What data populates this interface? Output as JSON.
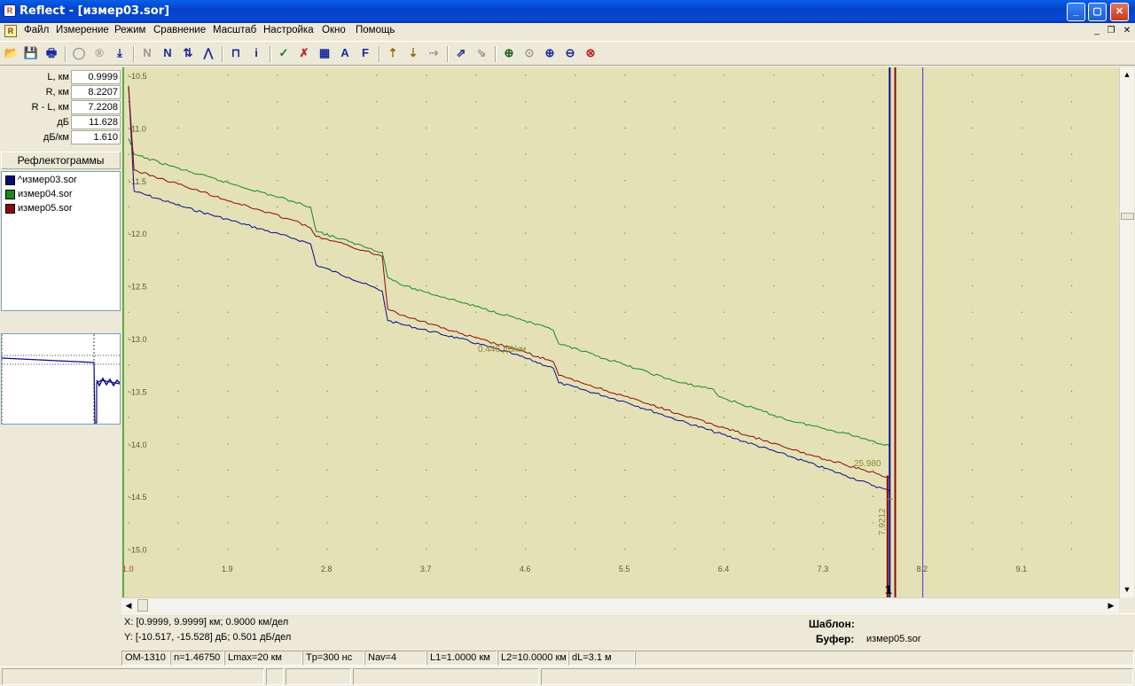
{
  "window": {
    "title": "Reflect - [измер03.sor]",
    "minimize_glyph": "_",
    "maximize_glyph": "▢",
    "close_glyph": "✕",
    "app_icon": "reflect-app-icon",
    "app_icon_glyph": "R"
  },
  "menu": {
    "doc_icon_glyph": "R",
    "items": [
      "Файл",
      "Измерение",
      "Режим",
      "Сравнение",
      "Масштаб",
      "Настройка",
      "Окно",
      "Помощь"
    ],
    "mdi_minimize": "_",
    "mdi_restore": "❐",
    "mdi_close": "✕"
  },
  "toolbar": {
    "icons": [
      {
        "name": "open-icon",
        "glyph": "📂"
      },
      {
        "name": "save-icon",
        "glyph": "💾"
      },
      {
        "name": "print-icon",
        "glyph": "🖶"
      },
      {
        "name": "measure-icon",
        "glyph": "◯"
      },
      {
        "name": "record-icon",
        "glyph": "®"
      },
      {
        "name": "download-icon",
        "glyph": "⤓"
      },
      {
        "name": "marker-n-disabled-icon",
        "glyph": "N"
      },
      {
        "name": "marker-n-icon",
        "glyph": "N"
      },
      {
        "name": "marker-n-arrows-icon",
        "glyph": "⇅"
      },
      {
        "name": "marker-n-peak-icon",
        "glyph": "⋀"
      },
      {
        "name": "event-table-icon",
        "glyph": "⊓"
      },
      {
        "name": "info-icon",
        "glyph": "i"
      },
      {
        "name": "check-icon",
        "glyph": "✓"
      },
      {
        "name": "delete-marker-icon",
        "glyph": "✗"
      },
      {
        "name": "table-icon",
        "glyph": "▦"
      },
      {
        "name": "font-a-icon",
        "glyph": "A"
      },
      {
        "name": "font-f-icon",
        "glyph": "F"
      },
      {
        "name": "compare-up-icon",
        "glyph": "⇡"
      },
      {
        "name": "compare-down-icon",
        "glyph": "⇣"
      },
      {
        "name": "compare-disabled-icon",
        "glyph": "⇢"
      },
      {
        "name": "export-icon",
        "glyph": "⇗"
      },
      {
        "name": "export-disabled-icon",
        "glyph": "⇘"
      },
      {
        "name": "zoom-in-icon",
        "glyph": "⊕"
      },
      {
        "name": "zoom-disabled-icon",
        "glyph": "⊙"
      },
      {
        "name": "zoom-fit-in-icon",
        "glyph": "⊕"
      },
      {
        "name": "zoom-fit-out-icon",
        "glyph": "⊖"
      },
      {
        "name": "zoom-reset-icon",
        "glyph": "⊗"
      }
    ]
  },
  "measurements": [
    {
      "label": "L, км",
      "value": "0.9999"
    },
    {
      "label": "R, км",
      "value": "8.2207"
    },
    {
      "label": "R - L, км",
      "value": "7.2208"
    },
    {
      "label": "дБ",
      "value": "11.628"
    },
    {
      "label": "дБ/км",
      "value": "1.610"
    }
  ],
  "reflectograms": {
    "header": "Рефлектограммы",
    "items": [
      {
        "name": "^измер03.sor",
        "color": "#0a0a78"
      },
      {
        "name": "измер04.sor",
        "color": "#1a8a1a"
      },
      {
        "name": "измер05.sor",
        "color": "#8a0a0a"
      }
    ]
  },
  "chart_data": {
    "type": "line",
    "x_ticks": [
      "1.0",
      "1.9",
      "2.8",
      "3.7",
      "4.6",
      "5.5",
      "6.4",
      "7.3",
      "8.2",
      "9.1"
    ],
    "y_ticks": [
      "-10.5",
      "-11.0",
      "-11.5",
      "-12.0",
      "-12.5",
      "-13.0",
      "-13.5",
      "-14.0",
      "-14.5",
      "-15.0"
    ],
    "xlim": [
      1.0,
      10.0
    ],
    "ylim": [
      -15.2,
      -10.4
    ],
    "grid": "dotted",
    "series": [
      {
        "name": "измер03.sor",
        "color": "#0a0a8a",
        "x": [
          1.0,
          1.05,
          1.5,
          2.0,
          2.5,
          2.65,
          2.7,
          3.0,
          3.3,
          3.35,
          3.5,
          4.0,
          4.5,
          4.85,
          4.9,
          5.5,
          6.0,
          6.5,
          7.0,
          7.5,
          7.9
        ],
        "y": [
          -10.6,
          -11.6,
          -11.75,
          -11.9,
          -12.05,
          -12.1,
          -12.3,
          -12.42,
          -12.55,
          -12.83,
          -12.87,
          -13.0,
          -13.15,
          -13.28,
          -13.42,
          -13.6,
          -13.78,
          -13.95,
          -14.12,
          -14.3,
          -14.45
        ]
      },
      {
        "name": "измер04.sor",
        "color": "#1a8a1a",
        "x": [
          1.0,
          1.05,
          1.5,
          2.0,
          2.5,
          2.65,
          2.7,
          3.0,
          3.3,
          3.35,
          3.5,
          4.0,
          4.5,
          4.85,
          4.9,
          5.5,
          6.0,
          6.3,
          6.35,
          7.0,
          7.5,
          7.9
        ],
        "y": [
          -11.1,
          -11.25,
          -11.4,
          -11.55,
          -11.7,
          -11.75,
          -11.98,
          -12.08,
          -12.18,
          -12.42,
          -12.5,
          -12.65,
          -12.8,
          -12.92,
          -13.05,
          -13.25,
          -13.42,
          -13.48,
          -13.55,
          -13.78,
          -13.9,
          -14.02
        ]
      },
      {
        "name": "измер05.sor",
        "color": "#8a0a0a",
        "x": [
          1.0,
          1.05,
          1.5,
          2.0,
          2.5,
          2.65,
          2.7,
          3.0,
          3.3,
          3.35,
          3.5,
          4.0,
          4.5,
          4.85,
          4.9,
          5.5,
          6.0,
          6.5,
          7.0,
          7.5,
          7.9
        ],
        "y": [
          -10.6,
          -11.4,
          -11.55,
          -11.72,
          -11.88,
          -11.95,
          -12.03,
          -12.12,
          -12.22,
          -12.72,
          -12.78,
          -12.95,
          -13.1,
          -13.22,
          -13.35,
          -13.55,
          -13.72,
          -13.88,
          -14.05,
          -14.2,
          -14.32
        ]
      }
    ],
    "annotations": {
      "slope_label": "0.446 дБ/км",
      "end_value_label": "25.980",
      "distance_label": "7.9212",
      "marker_number": "1"
    },
    "markers": [
      {
        "x": 7.9,
        "color": "#0a0a8a"
      },
      {
        "x": 7.95,
        "color": "#8a0a0a"
      },
      {
        "x": 8.2,
        "color": "#3a3ae0"
      }
    ]
  },
  "info": {
    "x_line": "X: [0.9999, 9.9999] км; 0.9000 км/дел",
    "y_line": "Y: [-10.517, -15.528] дБ; 0.501 дБ/дел",
    "template_label": "Шаблон:",
    "template_value": "",
    "buffer_label": "Буфер:",
    "buffer_value": "измер05.sor"
  },
  "status": {
    "device": "OM-1310",
    "n": "n=1.46750",
    "lmax": "Lmax=20 км",
    "tp": "Tp=300 нс",
    "nav": "Nav=4",
    "l1": "L1=1.0000 км",
    "l2": "L2=10.0000 км",
    "dl": "dL=3.1 м"
  },
  "scroll": {
    "up": "▲",
    "down": "▼",
    "left": "◀",
    "right": "▶"
  }
}
